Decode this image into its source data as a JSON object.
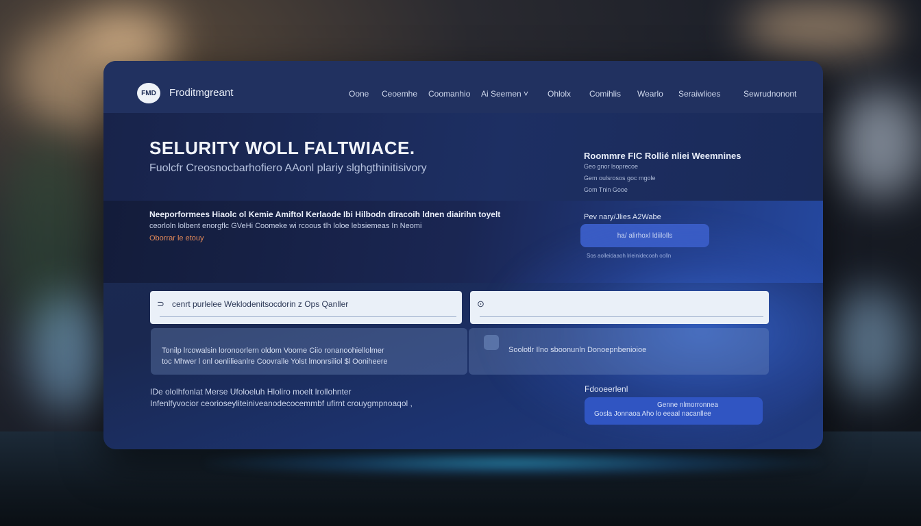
{
  "nav": {
    "logo_badge": "FMD",
    "brand": "Froditmgreant",
    "items": [
      "Oone",
      "Ceoemhe",
      "Coomanhio",
      "Ai  Seemen ˅",
      "Ohlolx",
      "Comihlis",
      "Wearlo",
      "Seraiwlioes",
      "Sewrudnonont"
    ]
  },
  "hero": {
    "title": "SELURITY  WOLL FALTWIACE.",
    "subtitle": "Fuolcfr Creosnocbarhofiero AAonl plariy  slghgthinitisivory",
    "side_title": "Roommre FIC Rollié nliei Weemnines",
    "side_lines": [
      "Geo gnor lsoprecoe",
      "Gem oulsrosos  goc mgole",
      "Gom Tnin Gooe"
    ]
  },
  "band": {
    "heading": "Neeporformees Hiaolc ol Kemie Amiftol Kerlaode Ibi Hilbodn diracoih ldnen  diairihn toyelt",
    "text": "ceorloln lolbent enorgflc GVeHi  Coomeke  wi rcoous tlh loloe lebsiemeas  In Neomi",
    "link": "Oborrar le etouy",
    "side_heading": "Pev nary/Jlies A2Wabe",
    "pill": "ha/           alirhoxl    ldiilolls",
    "note": "Sos aolleidaaoh lrieinidecoah oolln"
  },
  "inputs": {
    "left_value": "cenrt purlelee Weklodenitsocdorin z Ops  Qanller",
    "right_value": ""
  },
  "cards": {
    "left_line1": "Tonilp lrcowalsin loronoorlern  oldom Voome  Ciio ronanoohiellolmer",
    "left_line2": "toc Mhwer l onl oenlilieanlre Coovralle  Yolst lmonrsiliol  $l Ooniheere",
    "right_line": "Soolotlr  Ilno sboonunln  Donoepnbenioioe"
  },
  "footer": {
    "line1": "IDe ololhfonlat Merse Ufoloeluh Hloliro moelt lrollohnter",
    "line2": "Infenlfyvocior ceorioseyliteiniveanodecocemmbf ufirnt crouygmpnoaqol ,",
    "feedback_head": "Fdooeerlenl",
    "feedback_l1": "Genne nlmorronnea",
    "feedback_l2": "Gosla Jonnaoa  Aho  lo eeaal nacanllee"
  },
  "colors": {
    "panel": "#1d2c55",
    "navbar": "#213160",
    "accent": "#3055c2",
    "link": "#e48a5a",
    "input_bg": "#eaf0f8"
  }
}
